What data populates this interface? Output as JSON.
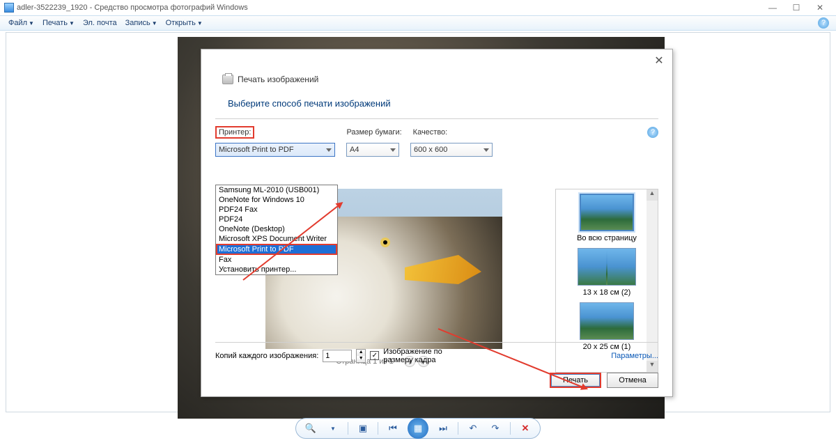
{
  "titlebar": {
    "filename": "adler-3522239_1920",
    "appname": "Средство просмотра фотографий Windows"
  },
  "menu": {
    "file": "Файл",
    "print": "Печать",
    "email": "Эл. почта",
    "burn": "Запись",
    "open": "Открыть"
  },
  "dialog": {
    "header": "Печать изображений",
    "subtitle": "Выберите способ печати изображений",
    "labels": {
      "printer": "Принтер:",
      "paper": "Размер бумаги:",
      "quality": "Качество:"
    },
    "printer_selected": "Microsoft Print to PDF",
    "paper_selected": "A4",
    "quality_selected": "600 x 600",
    "printer_options": [
      "Samsung ML-2010 (USB001)",
      "OneNote for Windows 10",
      "PDF24 Fax",
      "PDF24",
      "OneNote (Desktop)",
      "Microsoft XPS Document Writer",
      "Microsoft Print to PDF",
      "Fax",
      "Установить принтер..."
    ],
    "pager": "Страница 1 из 1",
    "layouts": {
      "l1": "Во всю страницу",
      "l2": "13 x 18 см (2)",
      "l3": "20 x 25 см (1)"
    },
    "copies_label": "Копий каждого изображения:",
    "copies_value": "1",
    "fit_label": "Изображение по размеру кадра",
    "fit_checked": true,
    "params": "Параметры...",
    "btn_print": "Печать",
    "btn_cancel": "Отмена"
  }
}
